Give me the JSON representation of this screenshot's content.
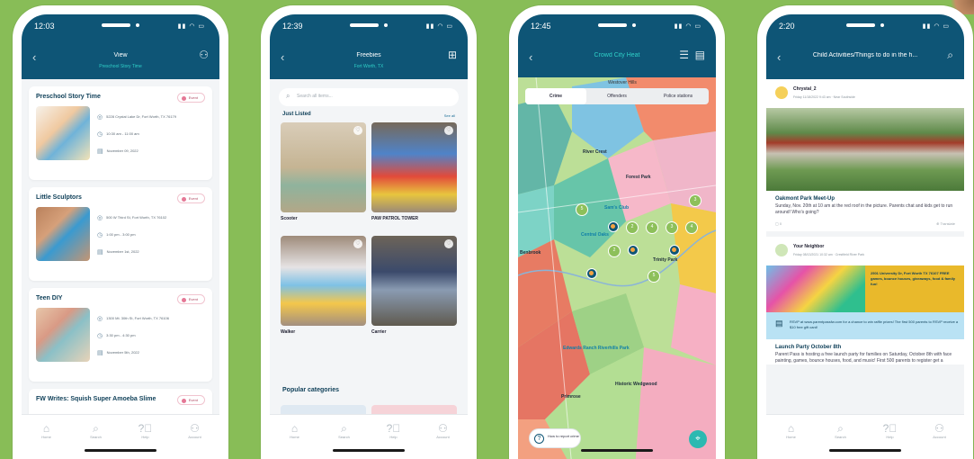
{
  "phone1": {
    "time": "12:03",
    "title": "View",
    "subtitle": "Preschool Story Time",
    "events": [
      {
        "name": "Preschool Story Time",
        "badge": "Event",
        "address": "5228 Crystal Lake Dr, Fort Worth, TX 76179",
        "time": "10:30 am - 11:00 am",
        "date": "November 09, 2022"
      },
      {
        "name": "Little Sculptors",
        "badge": "Event",
        "address": "500 W Third St, Fort Worth, TX 76102",
        "time": "1:00 pm - 3:00 pm",
        "date": "November 1st, 2022"
      },
      {
        "name": "Teen DIY",
        "badge": "Event",
        "address": "1300 Mt. 30th St, Fort Worth, TX 76106",
        "time": "3:30 pm - 4:30 pm",
        "date": "November 5th, 2022"
      },
      {
        "name": "FW Writes: Squish Super Amoeba Slime",
        "badge": "Event"
      }
    ]
  },
  "phone2": {
    "time": "12:39",
    "title": "Freebies",
    "subtitle": "Fort Worth, TX",
    "search_placeholder": "Search all items...",
    "section": "Just Listed",
    "see_all": "See all",
    "items": [
      {
        "label": "Scooter"
      },
      {
        "label": "PAW PATROL TOWER"
      },
      {
        "label": "Walker"
      },
      {
        "label": "Carrier"
      }
    ],
    "popular": "Popular categories"
  },
  "phone3": {
    "time": "12:45",
    "title": "Crowd City Heat",
    "top_place": "Westover Hills",
    "tabs": [
      "Crime",
      "Offenders",
      "Police stations"
    ],
    "places": {
      "river_crest": "River Crest",
      "sams": "Sam's Club",
      "benbrook": "Benbrook",
      "central": "Central Oaks",
      "trinity": "Trinity Park",
      "edwards": "Edwards Ranch Riverhills Park",
      "primrose": "Primrose",
      "historic": "Historic Wedgwood",
      "forest": "Forest Park"
    },
    "clusters": [
      "2",
      "4",
      "3",
      "4",
      "2",
      "5",
      "5",
      "3"
    ],
    "help_text": "How to report crime"
  },
  "phone4": {
    "time": "2:20",
    "title": "Child Activities/Things to do in the h...",
    "posts": [
      {
        "author": "Chrystal_2",
        "dateline": "Friday 11/18/2022 9:43 am · Near Southside",
        "title": "Oakmont Park Meet-Up",
        "body": "Sunday, Nov. 20th at 10 am at the red roof in the picture. Parents chat and kids get to run around! Who's going?",
        "comments": "0",
        "action": "Translate"
      },
      {
        "author": "Your Neighbor",
        "dateline": "Friday 08/13/2021 10:32 am · Crestfield River Park",
        "promo_right": "2501 University Dr, Fort Worth TX 76107 FREE games, bounce houses, giveaways, food & family fun!",
        "promo_bottom": "RSVP at www.parentpassfw.com for a chance to win raffle prizes! The first 500 parents to RSVP receive a $10 free gift card!",
        "title": "Launch Party October 8th",
        "body": "Parent Pass is hosting a free launch party for families on Saturday, October 8th with face painting, games, bounce houses, food, and music! First 500 parents to register get a"
      }
    ]
  },
  "tabbar": [
    "Home",
    "Search",
    "Help",
    "Account"
  ],
  "colors": {
    "header": "#0e5576",
    "accent": "#2cb9b1",
    "background": "#88bd57"
  }
}
